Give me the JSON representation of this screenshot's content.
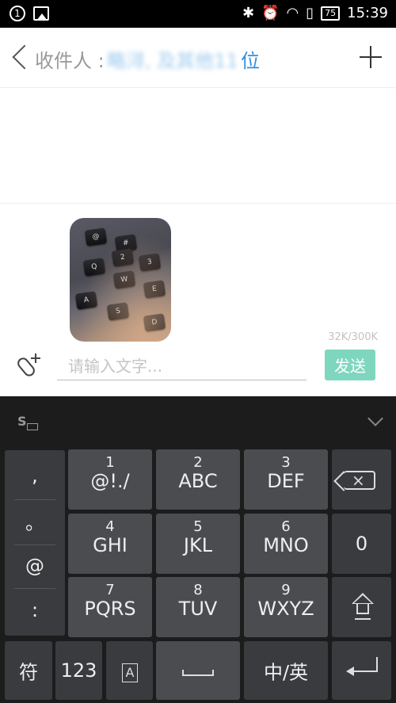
{
  "status_bar": {
    "notification_badge": "1",
    "battery": "75",
    "time": "15:39",
    "icons": [
      "bluetooth-icon",
      "alarm-icon",
      "wifi-icon",
      "sim-icon",
      "battery-icon"
    ]
  },
  "header": {
    "recipient_label": "收件人 :",
    "recipient_names": "略浔, 及其他11",
    "recipient_suffix": "位"
  },
  "compose": {
    "size_label": "32K/300K",
    "input_placeholder": "请输入文字...",
    "send_label": "发送",
    "accent_color": "#7fd6bf",
    "link_color": "#2d8fe0"
  },
  "thumbnail_keys": [
    "@",
    "#",
    "2",
    "3",
    "Q",
    "W",
    "E",
    "A",
    "S",
    "D"
  ],
  "keyboard": {
    "symbols": [
      ",",
      "。",
      "@",
      ":"
    ],
    "rows": [
      [
        {
          "num": "1",
          "label": "@!./"
        },
        {
          "num": "2",
          "label": "ABC"
        },
        {
          "num": "3",
          "label": "DEF"
        }
      ],
      [
        {
          "num": "4",
          "label": "GHI"
        },
        {
          "num": "5",
          "label": "JKL"
        },
        {
          "num": "6",
          "label": "MNO"
        }
      ],
      [
        {
          "num": "7",
          "label": "PQRS"
        },
        {
          "num": "8",
          "label": "TUV"
        },
        {
          "num": "9",
          "label": "WXYZ"
        }
      ]
    ],
    "zero": "0",
    "bottom": {
      "fu": "符",
      "num": "123",
      "a_icon": "A",
      "lang": "中/英"
    }
  }
}
